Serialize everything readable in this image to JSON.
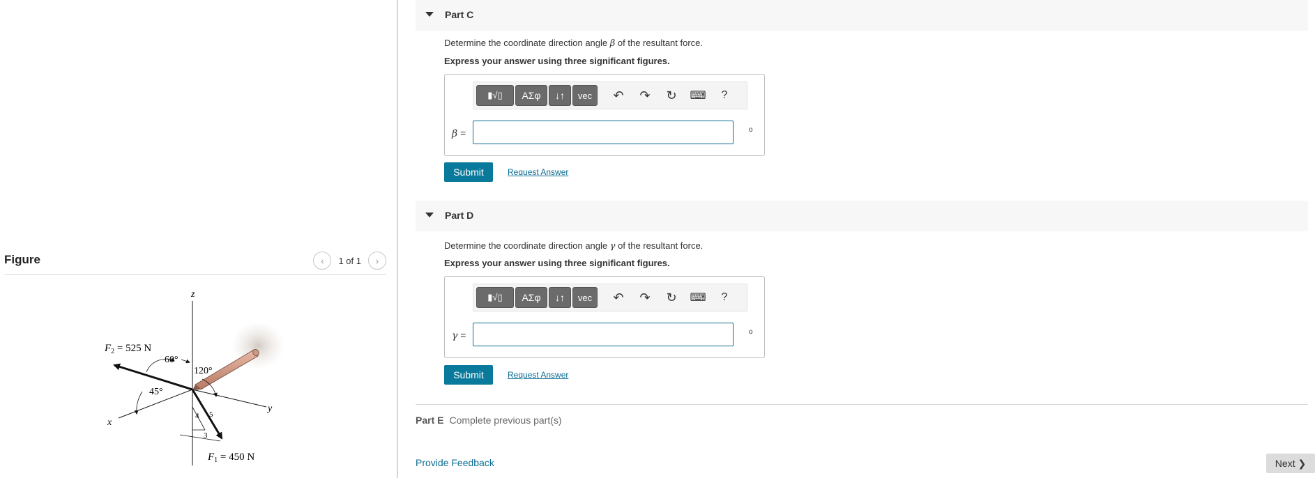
{
  "figure": {
    "title": "Figure",
    "pager": "1 of 1",
    "labels": {
      "z_axis": "z",
      "y_axis": "y",
      "x_axis": "x",
      "f2": "F",
      "f2_sub": "2",
      "f2_val": " = 525 N",
      "f1": "F",
      "f1_sub": "1",
      "f1_val": " = 450 N",
      "angle_60": "60°",
      "angle_120": "120°",
      "angle_45": "45°",
      "tri_4": "4",
      "tri_5": "5",
      "tri_3": "3"
    }
  },
  "parts": {
    "c": {
      "label": "Part C",
      "prompt_before": "Determine the coordinate direction angle ",
      "symbol": "β",
      "prompt_after": " of the resultant force.",
      "instruction": "Express your answer using three significant figures.",
      "var_label": "β",
      "eq": " =",
      "unit": "o",
      "submit": "Submit",
      "request": "Request Answer"
    },
    "d": {
      "label": "Part D",
      "prompt_before": "Determine the coordinate direction angle ",
      "symbol": "γ",
      "prompt_after": " of the resultant force.",
      "instruction": "Express your answer using three significant figures.",
      "var_label": "γ",
      "eq": " =",
      "unit": "o",
      "submit": "Submit",
      "request": "Request Answer"
    },
    "e": {
      "label": "Part E",
      "status": "Complete previous part(s)"
    }
  },
  "toolbar": {
    "templates": "▮√▯",
    "greek": "ΑΣφ",
    "updown": "↓↑",
    "vec": "vec",
    "undo": "↶",
    "redo": "↷",
    "reset": "↻",
    "keyboard": "⌨",
    "help": "?"
  },
  "footer": {
    "feedback": "Provide Feedback",
    "next": "Next ❯"
  }
}
